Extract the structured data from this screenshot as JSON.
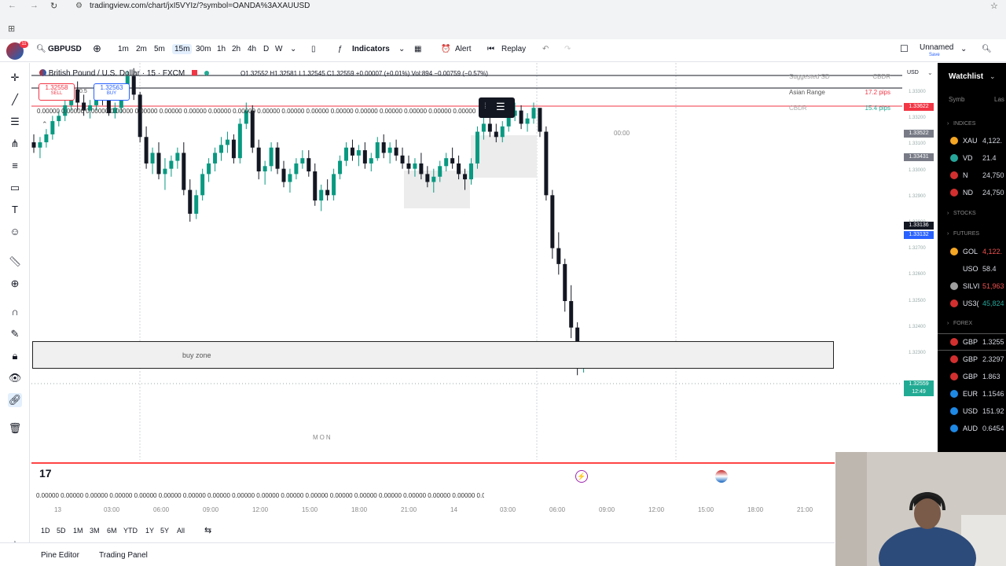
{
  "browser": {
    "url": "tradingview.com/chart/jxI5VYIz/?symbol=OANDA%3AXAUUSD"
  },
  "toolbar": {
    "symbol": "GBPUSD",
    "intervals": [
      "1m",
      "2m",
      "5m",
      "15m",
      "30m",
      "1h",
      "2h",
      "4h",
      "D",
      "W"
    ],
    "active_interval": "15m",
    "indicators_label": "Indicators",
    "alert_label": "Alert",
    "replay_label": "Replay",
    "layout_name": "Unnamed",
    "layout_sub": "Save"
  },
  "legend": {
    "title": "British Pound / U.S. Dollar · 15 · FXCM",
    "ohlc": "O1.32552 H1.32581 L1.32545 C1.32559 +0.00007 (+0.01%) Vol:894 −0.00759 (−0.57%)",
    "sell_price": "1.32558",
    "sell_label": "SELL",
    "spread": "0.5",
    "buy_price": "1.32563",
    "buy_label": "BUY",
    "zero_row": "0.00000  0.00000  0.00000  0.00000  0.00000  0.00000  0.00000  0.00000  0.00000  0.00000  0.00000  0.00000  0.00000  0.00000  0.00000  0.00000  0.00000  0.00000  0.00000  0.00000"
  },
  "overlay_table": {
    "rows": [
      {
        "label": "Suggested SD",
        "value": "CBDR"
      },
      {
        "label": "Asian Range",
        "value": "17.2 pips"
      },
      {
        "label": "CBDR",
        "value": "15.4 pips"
      }
    ]
  },
  "chart": {
    "buy_zone_label": "buy zone",
    "session_label": "MON",
    "time_marker": "00:00",
    "currency": "USD",
    "price_ticks": [
      "1.33300",
      "1.33200",
      "1.33100",
      "1.33000",
      "1.32900",
      "1.32800",
      "1.32700",
      "1.32600",
      "1.32500",
      "1.32400",
      "1.32300"
    ],
    "price_labels": {
      "red_line": "1.33622",
      "high": "1.33522",
      "mid": "1.33431",
      "dark_a": "1.33136",
      "blue_b": "1.33132",
      "current": "1.32559",
      "current_time": "12:49"
    },
    "candles_ohlc": [
      [
        1.334,
        1.3343,
        1.3336,
        1.3338
      ],
      [
        1.3338,
        1.3342,
        1.3334,
        1.334
      ],
      [
        1.334,
        1.3345,
        1.3338,
        1.3343
      ],
      [
        1.3343,
        1.335,
        1.3341,
        1.3348
      ],
      [
        1.3348,
        1.3352,
        1.3346,
        1.335
      ],
      [
        1.335,
        1.3356,
        1.3348,
        1.3354
      ],
      [
        1.3354,
        1.3362,
        1.3352,
        1.336
      ],
      [
        1.336,
        1.3363,
        1.3352,
        1.3355
      ],
      [
        1.3355,
        1.3358,
        1.335,
        1.3352
      ],
      [
        1.3352,
        1.3356,
        1.3349,
        1.3354
      ],
      [
        1.3354,
        1.336,
        1.3352,
        1.3358
      ],
      [
        1.3358,
        1.3362,
        1.3354,
        1.3356
      ],
      [
        1.3356,
        1.3358,
        1.335,
        1.3351
      ],
      [
        1.3351,
        1.3355,
        1.3349,
        1.3353
      ],
      [
        1.3353,
        1.336,
        1.3351,
        1.3358
      ],
      [
        1.3358,
        1.3367,
        1.3356,
        1.3365
      ],
      [
        1.3365,
        1.3368,
        1.3356,
        1.3358
      ],
      [
        1.3358,
        1.3359,
        1.334,
        1.3342
      ],
      [
        1.3342,
        1.3346,
        1.333,
        1.3332
      ],
      [
        1.3332,
        1.3338,
        1.3328,
        1.3336
      ],
      [
        1.3336,
        1.334,
        1.3326,
        1.3328
      ],
      [
        1.3328,
        1.3334,
        1.3322,
        1.333
      ],
      [
        1.333,
        1.3335,
        1.3327,
        1.3333
      ],
      [
        1.3333,
        1.3338,
        1.333,
        1.3336
      ],
      [
        1.3336,
        1.334,
        1.332,
        1.3322
      ],
      [
        1.3322,
        1.3326,
        1.331,
        1.3313
      ],
      [
        1.3313,
        1.3322,
        1.3311,
        1.332
      ],
      [
        1.332,
        1.333,
        1.3318,
        1.3328
      ],
      [
        1.3328,
        1.3334,
        1.3325,
        1.3332
      ],
      [
        1.3332,
        1.3338,
        1.3329,
        1.3336
      ],
      [
        1.3336,
        1.3342,
        1.3333,
        1.3339
      ],
      [
        1.3339,
        1.3344,
        1.3336,
        1.3341
      ],
      [
        1.3341,
        1.3343,
        1.3332,
        1.3334
      ],
      [
        1.3334,
        1.3349,
        1.3332,
        1.3347
      ],
      [
        1.3347,
        1.3355,
        1.3345,
        1.3352
      ],
      [
        1.3352,
        1.3354,
        1.3336,
        1.3338
      ],
      [
        1.3338,
        1.3341,
        1.3326,
        1.3329
      ],
      [
        1.3329,
        1.3333,
        1.3324,
        1.3331
      ],
      [
        1.3331,
        1.334,
        1.3329,
        1.3338
      ],
      [
        1.3338,
        1.334,
        1.3328,
        1.333
      ],
      [
        1.333,
        1.3333,
        1.3323,
        1.3325
      ],
      [
        1.3325,
        1.333,
        1.3321,
        1.3328
      ],
      [
        1.3328,
        1.3334,
        1.3326,
        1.3332
      ],
      [
        1.3332,
        1.3337,
        1.333,
        1.3334
      ],
      [
        1.3334,
        1.3337,
        1.3327,
        1.3329
      ],
      [
        1.3329,
        1.3332,
        1.3316,
        1.3318
      ],
      [
        1.3318,
        1.3324,
        1.3314,
        1.3322
      ],
      [
        1.3322,
        1.3326,
        1.3318,
        1.332
      ],
      [
        1.332,
        1.333,
        1.3318,
        1.3328
      ],
      [
        1.3328,
        1.3335,
        1.3326,
        1.3333
      ],
      [
        1.3333,
        1.334,
        1.3331,
        1.3338
      ],
      [
        1.3338,
        1.3341,
        1.3333,
        1.3335
      ],
      [
        1.3335,
        1.3339,
        1.3331,
        1.3337
      ],
      [
        1.3337,
        1.334,
        1.333,
        1.3332
      ],
      [
        1.3332,
        1.3336,
        1.3329,
        1.3334
      ],
      [
        1.3334,
        1.3342,
        1.3333,
        1.334
      ],
      [
        1.334,
        1.3343,
        1.3334,
        1.3336
      ],
      [
        1.3336,
        1.334,
        1.3332,
        1.3338
      ],
      [
        1.3338,
        1.3341,
        1.3333,
        1.3335
      ],
      [
        1.3335,
        1.3338,
        1.333,
        1.3332
      ],
      [
        1.3332,
        1.3335,
        1.3328,
        1.333
      ],
      [
        1.333,
        1.3334,
        1.3327,
        1.3332
      ],
      [
        1.3332,
        1.3336,
        1.3326,
        1.3328
      ],
      [
        1.3328,
        1.3331,
        1.3323,
        1.3325
      ],
      [
        1.3325,
        1.333,
        1.3321,
        1.3327
      ],
      [
        1.3327,
        1.3333,
        1.3325,
        1.3331
      ],
      [
        1.3331,
        1.3336,
        1.3329,
        1.3334
      ],
      [
        1.3334,
        1.3338,
        1.333,
        1.3332
      ],
      [
        1.3332,
        1.3335,
        1.3326,
        1.3328
      ],
      [
        1.3328,
        1.333,
        1.3322,
        1.3326
      ],
      [
        1.3326,
        1.3334,
        1.3324,
        1.3332
      ],
      [
        1.3332,
        1.3346,
        1.333,
        1.3344
      ],
      [
        1.3344,
        1.335,
        1.3341,
        1.3347
      ],
      [
        1.3347,
        1.335,
        1.3342,
        1.3344
      ],
      [
        1.3344,
        1.3347,
        1.334,
        1.3342
      ],
      [
        1.3342,
        1.3348,
        1.334,
        1.3346
      ],
      [
        1.3346,
        1.3352,
        1.3344,
        1.335
      ],
      [
        1.335,
        1.3355,
        1.3348,
        1.3352
      ],
      [
        1.3352,
        1.3354,
        1.3345,
        1.3347
      ],
      [
        1.3347,
        1.3351,
        1.3344,
        1.3349
      ],
      [
        1.3349,
        1.3355,
        1.3347,
        1.3353
      ],
      [
        1.3353,
        1.3352,
        1.3342,
        1.3344
      ],
      [
        1.3344,
        1.3346,
        1.3318,
        1.332
      ],
      [
        1.332,
        1.3322,
        1.3296,
        1.33
      ],
      [
        1.33,
        1.3306,
        1.329,
        1.3294
      ],
      [
        1.3294,
        1.3296,
        1.3276,
        1.328
      ],
      [
        1.328,
        1.3286,
        1.3266,
        1.327
      ],
      [
        1.327,
        1.3272,
        1.3252,
        1.3256
      ],
      [
        1.3256,
        1.3258,
        1.3253,
        1.3256
      ]
    ]
  },
  "time_axis": {
    "ticks": [
      "13",
      "03:00",
      "06:00",
      "09:00",
      "12:00",
      "15:00",
      "18:00",
      "21:00",
      "14",
      "03:00",
      "06:00",
      "09:00",
      "12:00",
      "15:00",
      "18:00",
      "21:00"
    ]
  },
  "range_bar": {
    "ranges": [
      "1D",
      "5D",
      "1M",
      "3M",
      "6M",
      "YTD",
      "1Y",
      "5Y",
      "All"
    ]
  },
  "bottom_bar": {
    "tabs": [
      "Pine Editor",
      "Trading Panel"
    ]
  },
  "watchlist": {
    "title": "Watchlist",
    "col_symbol": "Symb",
    "col_last": "Las",
    "sections": [
      "INDICES",
      "STOCKS",
      "FUTURES",
      "FOREX"
    ],
    "indices": [
      {
        "sym": "XAU",
        "val": "4,122.",
        "color": "#f5a623",
        "val_color": "#d1d4dc"
      },
      {
        "sym": "VD",
        "val": "21.4",
        "color": "#26a69a",
        "val_color": "#d1d4dc"
      },
      {
        "sym": "N",
        "val": "24,750",
        "color": "#d32f2f",
        "val_color": "#d1d4dc"
      },
      {
        "sym": "ND",
        "val": "24,750",
        "color": "#d32f2f",
        "val_color": "#d1d4dc"
      }
    ],
    "futures": [
      {
        "sym": "GOL",
        "val": "4,122.",
        "color": "#f5a623",
        "val_color": "#ef5350"
      },
      {
        "sym": "USO",
        "val": "58.4",
        "color": "#000000",
        "val_color": "#d1d4dc"
      },
      {
        "sym": "SILVI",
        "val": "51,963",
        "color": "#9e9e9e",
        "val_color": "#ef5350"
      },
      {
        "sym": "US3(",
        "val": "45,824",
        "color": "#d32f2f",
        "val_color": "#26a69a"
      }
    ],
    "forex": [
      {
        "sym": "GBP",
        "val": "1.3255",
        "color": "#d32f2f",
        "val_color": "#d1d4dc"
      },
      {
        "sym": "GBP",
        "val": "2.3297",
        "color": "#d32f2f",
        "val_color": "#d1d4dc"
      },
      {
        "sym": "GBP",
        "val": "1.863",
        "color": "#d32f2f",
        "val_color": "#d1d4dc"
      },
      {
        "sym": "EUR",
        "val": "1.1546",
        "color": "#1e88e5",
        "val_color": "#d1d4dc"
      },
      {
        "sym": "USD",
        "val": "151.92",
        "color": "#1e88e5",
        "val_color": "#d1d4dc"
      },
      {
        "sym": "AUD",
        "val": "0.6454",
        "color": "#1e88e5",
        "val_color": "#d1d4dc"
      }
    ]
  },
  "colors": {
    "up": "#089981",
    "down": "#131722",
    "accent": "#2962ff",
    "red_line": "#f23645",
    "current_price": "#22ab94"
  }
}
